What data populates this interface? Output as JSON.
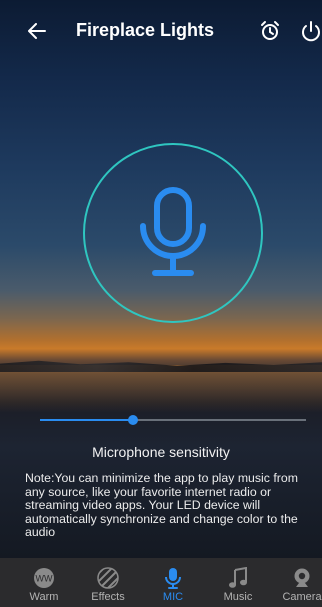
{
  "header": {
    "title": "Fireplace Lights",
    "back_icon": "back-arrow-icon",
    "alarm_icon": "alarm-clock-icon",
    "power_icon": "power-icon"
  },
  "mic": {
    "icon": "microphone-icon",
    "ring_color": "#2fc6c0",
    "icon_color": "#2a8cf0"
  },
  "sensitivity": {
    "label": "Microphone sensitivity",
    "value": 0.35
  },
  "note": "Note:You can minimize the app to play music from any source, like your favorite internet radio or streaming video apps. Your LED device will automatically synchronize and change color to the audio",
  "nav": {
    "active": "MIC",
    "items": [
      {
        "label": "Warm",
        "icon": "ww-icon",
        "badge": "WW"
      },
      {
        "label": "Effects",
        "icon": "effects-icon"
      },
      {
        "label": "MIC",
        "icon": "microphone-icon"
      },
      {
        "label": "Music",
        "icon": "music-note-icon"
      },
      {
        "label": "Camera",
        "icon": "camera-icon"
      }
    ]
  },
  "colors": {
    "accent": "#2a8cf0",
    "nav_bg": "#2b2b2d"
  }
}
